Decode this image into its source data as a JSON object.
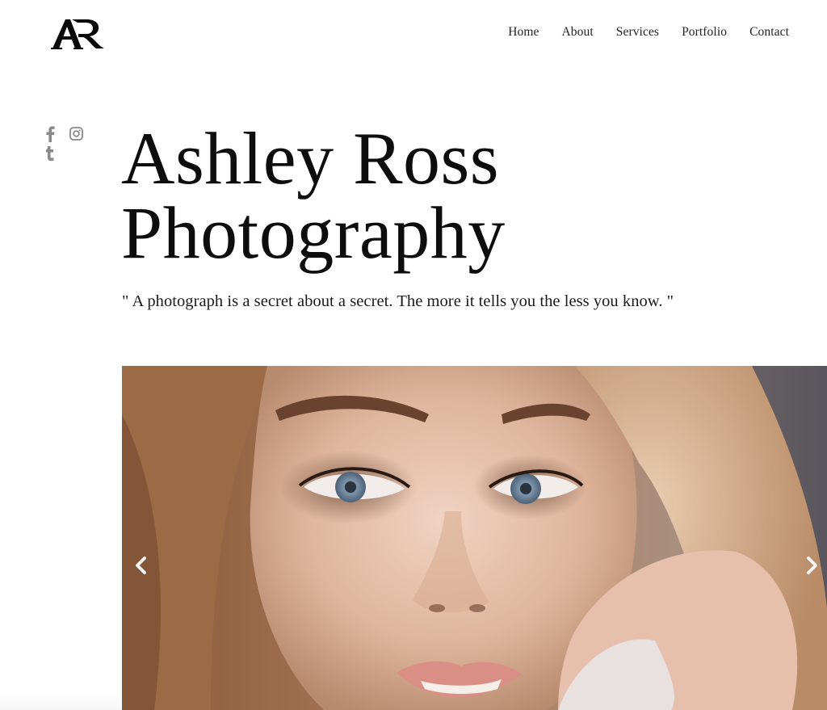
{
  "brand": {
    "logo_text": "AR",
    "logo_icon": "ar-monogram-logo"
  },
  "nav": {
    "items": [
      {
        "label": "Home"
      },
      {
        "label": "About"
      },
      {
        "label": "Services"
      },
      {
        "label": "Portfolio"
      },
      {
        "label": "Contact"
      }
    ]
  },
  "social": {
    "icons": [
      "facebook-icon",
      "instagram-icon",
      "tumblr-icon"
    ],
    "color": "#8a8888"
  },
  "hero": {
    "title_line1": "Ashley Ross",
    "title_line2": "Photography",
    "quote": "\" A photograph is a secret about a secret. The more it tells you the less you know. \""
  },
  "slider": {
    "image_alt": "Close-up portrait of a woman with blonde hair and blue eyes",
    "prev_icon": "chevron-left-icon",
    "next_icon": "chevron-right-icon"
  }
}
